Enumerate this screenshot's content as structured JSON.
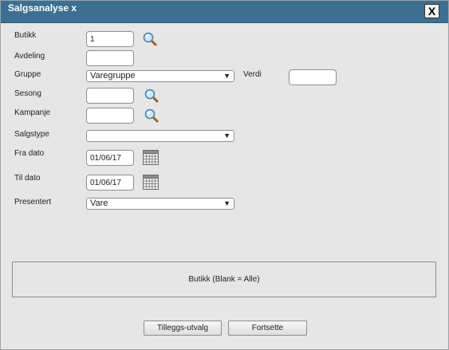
{
  "window": {
    "title": "Salgsanalyse x",
    "close_label": "X"
  },
  "form": {
    "butikk": {
      "label": "Butikk",
      "value": "1"
    },
    "avdeling": {
      "label": "Avdeling",
      "value": ""
    },
    "gruppe": {
      "label": "Gruppe",
      "selected": "Varegruppe"
    },
    "verdi": {
      "label": "Verdi",
      "value": ""
    },
    "sesong": {
      "label": "Sesong",
      "value": ""
    },
    "kampanje": {
      "label": "Kampanje",
      "value": ""
    },
    "salgstype": {
      "label": "Salgstype",
      "selected": ""
    },
    "fra_dato": {
      "label": "Fra dato",
      "value": "01/06/17"
    },
    "til_dato": {
      "label": "Til dato",
      "value": "01/06/17"
    },
    "presentert": {
      "label": "Presentert",
      "selected": "Vare"
    }
  },
  "info": {
    "text": "Butikk (Blank = Alle)"
  },
  "buttons": {
    "tilleggs": "Tilleggs-utvalg",
    "fortsette": "Fortsette"
  },
  "icons": {
    "lookup": "magnifier-icon",
    "calendar": "calendar-icon",
    "dropdown": "chevron-down-icon"
  },
  "colors": {
    "titlebar": "#3d6f91",
    "background": "#e6e6e6"
  }
}
